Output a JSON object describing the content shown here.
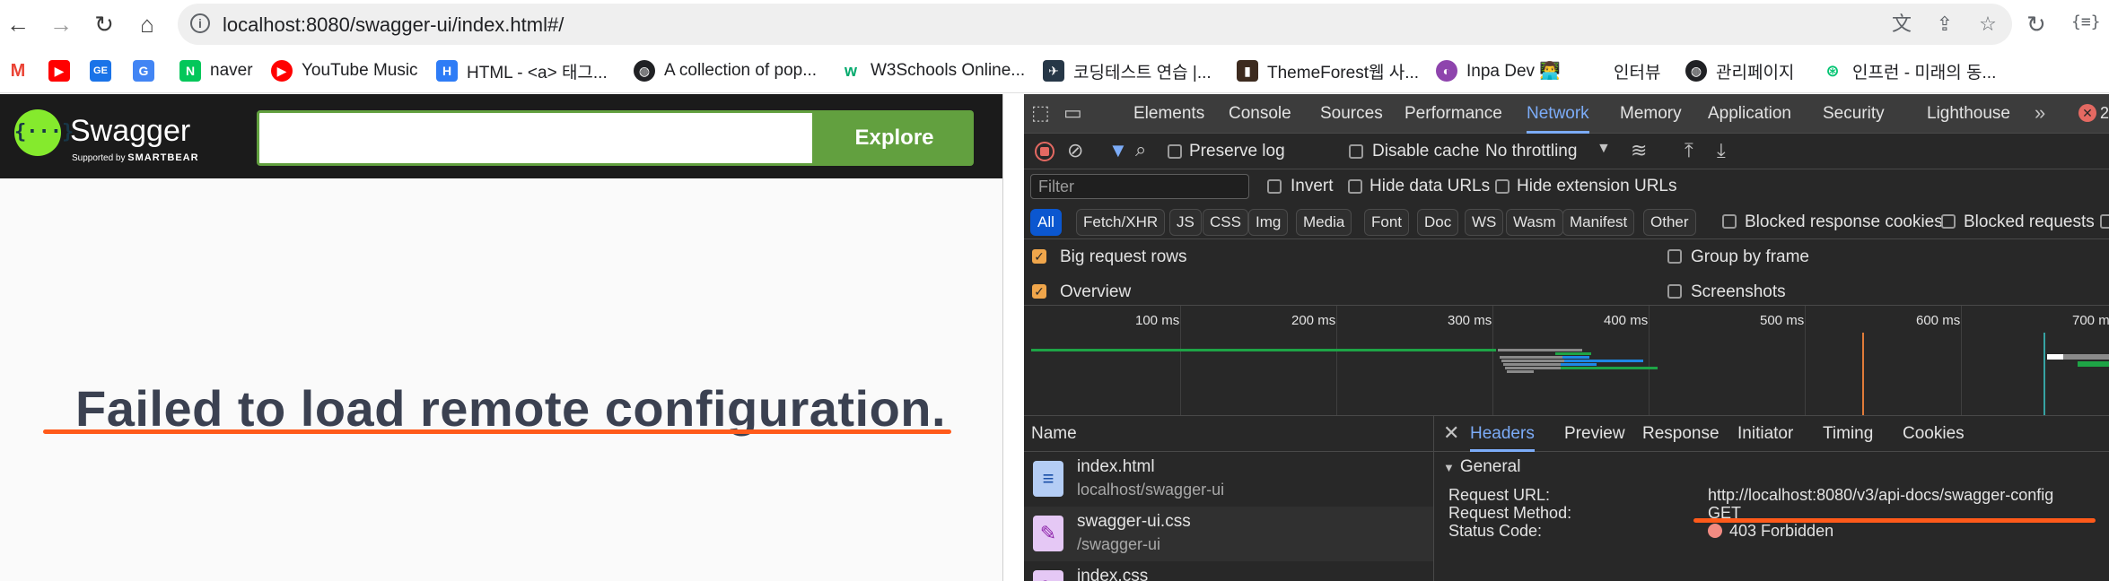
{
  "browser": {
    "url": "localhost:8080/swagger-ui/index.html#/",
    "bookmarks": [
      {
        "label": "",
        "icon": "gmail-icon"
      },
      {
        "label": "",
        "icon": "youtube-icon"
      },
      {
        "label": "",
        "icon": "google-sheets-icon"
      },
      {
        "label": "",
        "icon": "google-translate-icon"
      },
      {
        "label": "naver",
        "icon": "naver-icon"
      },
      {
        "label": "YouTube Music",
        "icon": "youtube-music-icon"
      },
      {
        "label": "HTML - <a> 태그...",
        "icon": "html-icon"
      },
      {
        "label": "A collection of pop...",
        "icon": "globe-icon"
      },
      {
        "label": "W3Schools Online...",
        "icon": "w3schools-icon"
      },
      {
        "label": "코딩테스트 연습 |...",
        "icon": "programmers-icon"
      },
      {
        "label": "ThemeForest웹 사...",
        "icon": "themeforest-icon"
      },
      {
        "label": "Inpa Dev 👨‍💻",
        "icon": "inpa-icon"
      },
      {
        "label": "인터뷰",
        "icon": "none"
      },
      {
        "label": "관리페이지",
        "icon": "globe-icon"
      },
      {
        "label": "인프런 - 미래의 동...",
        "icon": "inflearn-icon"
      }
    ]
  },
  "swagger": {
    "logo_text": "Swagger",
    "logo_sub_prefix": "Supported by",
    "logo_sub_brand": "SMARTBEAR",
    "explore_label": "Explore",
    "input_value": "",
    "error_message": "Failed to load remote configuration."
  },
  "devtools": {
    "tabs": [
      "Elements",
      "Console",
      "Sources",
      "Performance",
      "Network",
      "Memory",
      "Application",
      "Security",
      "Lighthouse"
    ],
    "active_tab": "Network",
    "error_count": "2",
    "toolbar": {
      "preserve_log": "Preserve log",
      "disable_cache": "Disable cache",
      "throttling": "No throttling"
    },
    "filter": {
      "placeholder": "Filter",
      "invert": "Invert",
      "hide_data_urls": "Hide data URLs",
      "hide_extension_urls": "Hide extension URLs"
    },
    "types": [
      "All",
      "Fetch/XHR",
      "JS",
      "CSS",
      "Img",
      "Media",
      "Font",
      "Doc",
      "WS",
      "Wasm",
      "Manifest",
      "Other"
    ],
    "active_type": "All",
    "blocked_response_cookies": "Blocked response cookies",
    "blocked_requests": "Blocked requests",
    "options": {
      "big_request_rows": "Big request rows",
      "overview": "Overview",
      "group_by_frame": "Group by frame",
      "screenshots": "Screenshots"
    },
    "timeline_ticks": [
      "100 ms",
      "200 ms",
      "300 ms",
      "400 ms",
      "500 ms",
      "600 ms",
      "700 m"
    ],
    "name_header": "Name",
    "requests": [
      {
        "name": "index.html",
        "path": "localhost/swagger-ui",
        "icon": "document-icon"
      },
      {
        "name": "swagger-ui.css",
        "path": "/swagger-ui",
        "icon": "stylesheet-icon"
      },
      {
        "name": "index.css",
        "path": "",
        "icon": "stylesheet-icon"
      }
    ],
    "detail_tabs": [
      "Headers",
      "Preview",
      "Response",
      "Initiator",
      "Timing",
      "Cookies"
    ],
    "active_detail_tab": "Headers",
    "general": {
      "title": "General",
      "request_url_key": "Request URL:",
      "request_url": "http://localhost:8080/v3/api-docs/swagger-config",
      "method_key": "Request Method:",
      "method": "GET",
      "status_key": "Status Code:",
      "status": "403 Forbidden"
    }
  },
  "colors": {
    "annotation": "#ff5a1a",
    "swagger_green": "#62a03f",
    "devtools_accent": "#7cacf8"
  }
}
